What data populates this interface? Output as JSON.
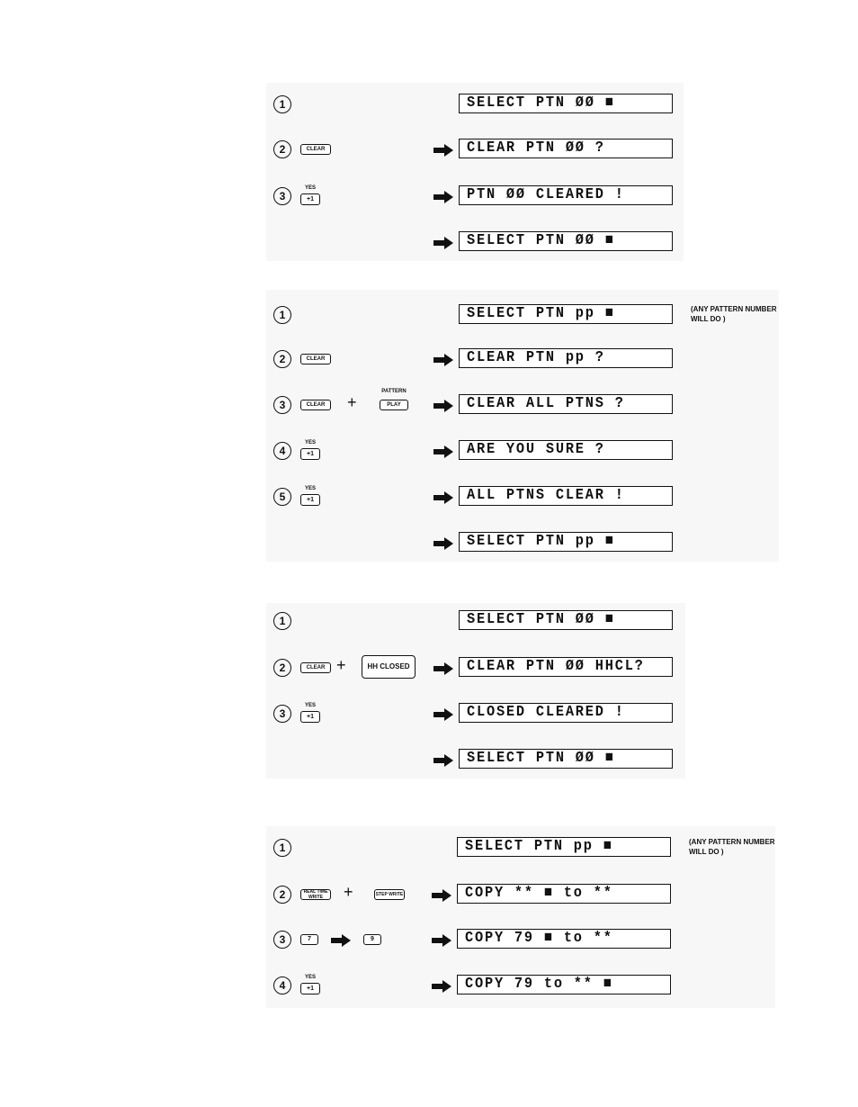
{
  "keys": {
    "clear": "CLEAR",
    "yes_cap": "YES",
    "plus_one": "+1",
    "pattern_cap": "PATTERN",
    "play": "PLAY",
    "hh_closed": "HH CLOSED",
    "real_time_write": "REAL TIME WRITE",
    "step_write": "STEP WRITE",
    "seven": "7",
    "nine": "9",
    "plus": "+"
  },
  "note": "(ANY PATTERN NUMBER WILL DO )",
  "sections": [
    {
      "steps": [
        {
          "num": "①",
          "display": "SELECT PTN ØØ ■"
        },
        {
          "num": "②",
          "display": "CLEAR PTN ØØ ?"
        },
        {
          "num": "③",
          "display": "PTN ØØ CLEARED !"
        },
        {
          "num": "",
          "display": "SELECT PTN ØØ ■"
        }
      ]
    },
    {
      "steps": [
        {
          "num": "①",
          "display": "SELECT PTN pp ■"
        },
        {
          "num": "②",
          "display": "CLEAR PTN pp ?"
        },
        {
          "num": "③",
          "display": "CLEAR ALL PTNS ?"
        },
        {
          "num": "④",
          "display": "ARE YOU SURE ?"
        },
        {
          "num": "⑤",
          "display": "ALL PTNS CLEAR !"
        },
        {
          "num": "",
          "display": "SELECT PTN pp ■"
        }
      ]
    },
    {
      "steps": [
        {
          "num": "①",
          "display": "SELECT PTN ØØ ■"
        },
        {
          "num": "②",
          "display": "CLEAR PTN ØØ HHCL?"
        },
        {
          "num": "③",
          "display": "CLOSED CLEARED !"
        },
        {
          "num": "",
          "display": "SELECT PTN ØØ ■"
        }
      ]
    },
    {
      "steps": [
        {
          "num": "①",
          "display": "SELECT PTN pp ■"
        },
        {
          "num": "②",
          "display": "COPY ** ■ to **"
        },
        {
          "num": "③",
          "display": "COPY 79 ■ to **"
        },
        {
          "num": "④",
          "display": "COPY 79 to ** ■"
        }
      ]
    }
  ]
}
